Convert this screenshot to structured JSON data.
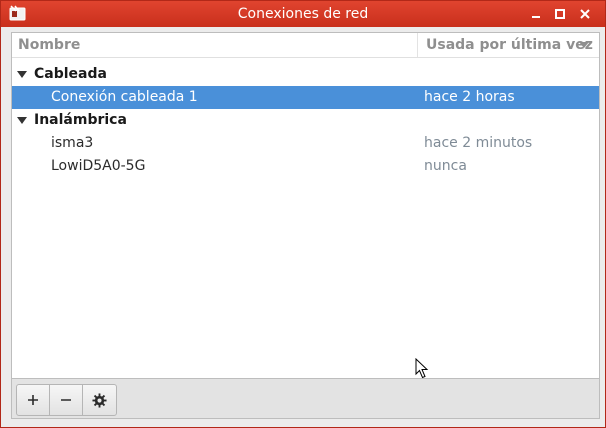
{
  "window": {
    "title": "Conexiones de red",
    "accent": "#d23a25",
    "controls": [
      "minimize-icon",
      "maximize-icon",
      "close-icon"
    ]
  },
  "columns": {
    "name": "Nombre",
    "used": "Usada por última vez"
  },
  "groups": [
    {
      "label": "Cableada",
      "items": [
        {
          "name": "Conexión cableada 1",
          "used": "hace 2 horas",
          "selected": true
        }
      ]
    },
    {
      "label": "Inalámbrica",
      "items": [
        {
          "name": "isma3",
          "used": "hace 2 minutos",
          "selected": false
        },
        {
          "name": "LowiD5A0-5G",
          "used": "nunca",
          "selected": false
        }
      ]
    }
  ],
  "toolbar": {
    "buttons": [
      "add-icon",
      "remove-icon",
      "settings-gear-icon"
    ]
  },
  "selection_color": "#4a90d9"
}
